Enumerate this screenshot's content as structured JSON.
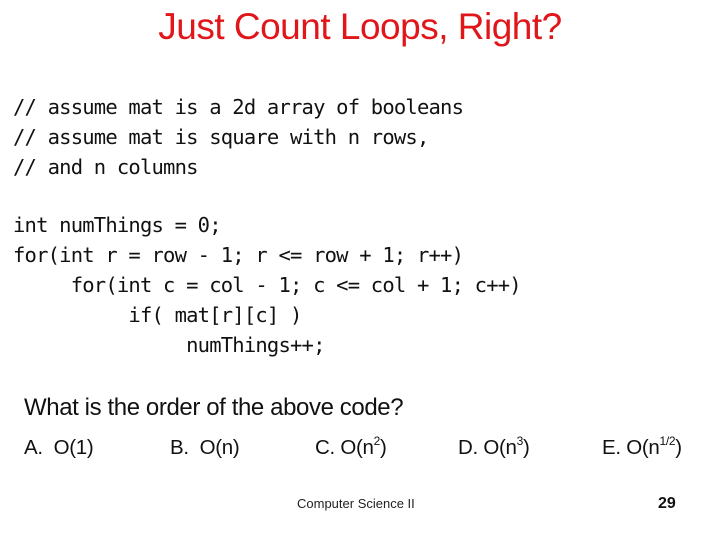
{
  "slide": {
    "title": "Just Count Loops, Right?",
    "comments": [
      "// assume mat is a 2d array of booleans",
      "// assume mat is square with n rows,",
      "// and n columns"
    ],
    "code": [
      "int numThings = 0;",
      "for(int r = row - 1; r <= row + 1; r++)",
      "     for(int c = col - 1; c <= col + 1; c++)",
      "          if( mat[r][c] )",
      "               numThings++;"
    ],
    "question": "What is the order of the above code?",
    "answers": [
      {
        "letter": "A.",
        "base": "O(1)",
        "exp": "",
        "tail": ""
      },
      {
        "letter": "B.",
        "base": "O(n)",
        "exp": "",
        "tail": ""
      },
      {
        "letter": "C.",
        "base": "O(n",
        "exp": "2",
        "tail": ")"
      },
      {
        "letter": "D.",
        "base": "O(n",
        "exp": "3",
        "tail": ")"
      },
      {
        "letter": "E.",
        "base": "O(n",
        "exp": "1/2",
        "tail": ")"
      }
    ],
    "footer": "Computer Science II",
    "page_number": "29"
  }
}
